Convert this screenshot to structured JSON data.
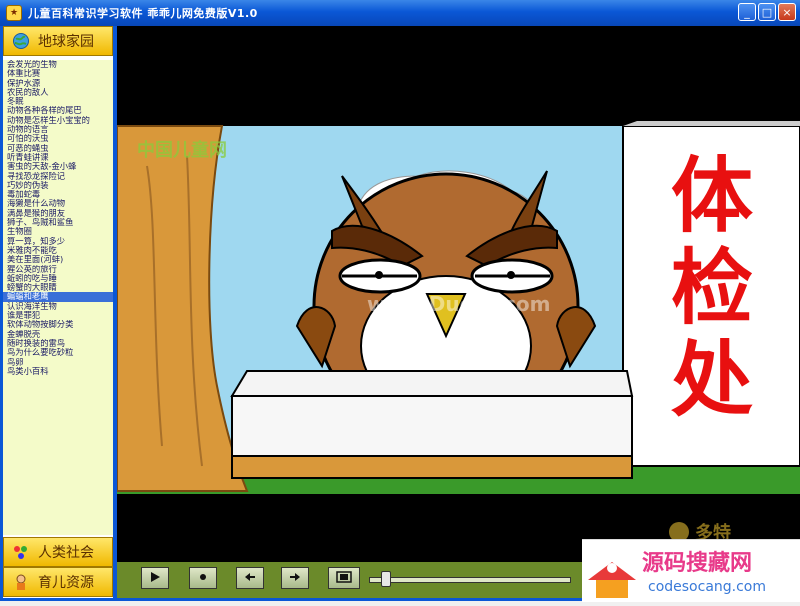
{
  "window": {
    "title": "儿童百科常识学习软件 乖乖儿网免费版V1.0",
    "buttons": {
      "minimize": "_",
      "maximize": "□",
      "close": "×"
    }
  },
  "sidebar": {
    "top_category": "地球家园",
    "categories_bottom": [
      "人类社会",
      "育儿资源"
    ],
    "items": [
      "会发光的生物",
      "体重比赛",
      "保护水源",
      "农民的敌人",
      "冬眠",
      "动物各种各样的尾巴",
      "动物是怎样生小宝宝的",
      "动物的语言",
      "可怕的沃虫",
      "可恶的蝇虫",
      "听青蛙讲课",
      "害虫的天敌-金小蜂",
      "寻找恐龙探险记",
      "巧妙的伪装",
      "毒加蛇毒",
      "海獭是什么动物",
      "满鼻是猴的朋友",
      "狮子、鸟贼和鲨鱼",
      "生物圈",
      "算一算，知多少",
      "米雅肉不能吃",
      "美在里面(河蚌)",
      "猩公英的旅行",
      "蚯蚓的吃与睡",
      "螃蟹的大眼睛",
      "蝙蝠和老鹰",
      "认识海洋生物",
      "谁是罪犯",
      "软体动物按脚分类",
      "金蝉脱壳",
      "随时换装的雷鸟",
      "鸟为什么要吃砂粒",
      "鸟卵",
      "鸟类小百科"
    ],
    "selected_index": 25
  },
  "stage": {
    "sign_text": [
      "体",
      "检",
      "处"
    ],
    "watermark_logo": "中国儿童网",
    "owl_watermark": "www.Duote.com",
    "brand_text": "多特"
  },
  "controls": {
    "play_icon": "play-icon",
    "stop_icon": "stop-icon",
    "back_icon": "back-icon",
    "forward_icon": "forward-icon",
    "fullscreen_icon": "fullscreen-icon",
    "progress": 0.06
  },
  "ad": {
    "title": "源码搜藏网",
    "url": "codesocang.com"
  },
  "colors": {
    "titlebar": "#0a57d6",
    "accent_yellow": "#f0b800",
    "list_bg": "#f4fbc9",
    "selected": "#3a6fd8",
    "sign_red": "#e81010",
    "control_bar": "#6b8a2a"
  }
}
